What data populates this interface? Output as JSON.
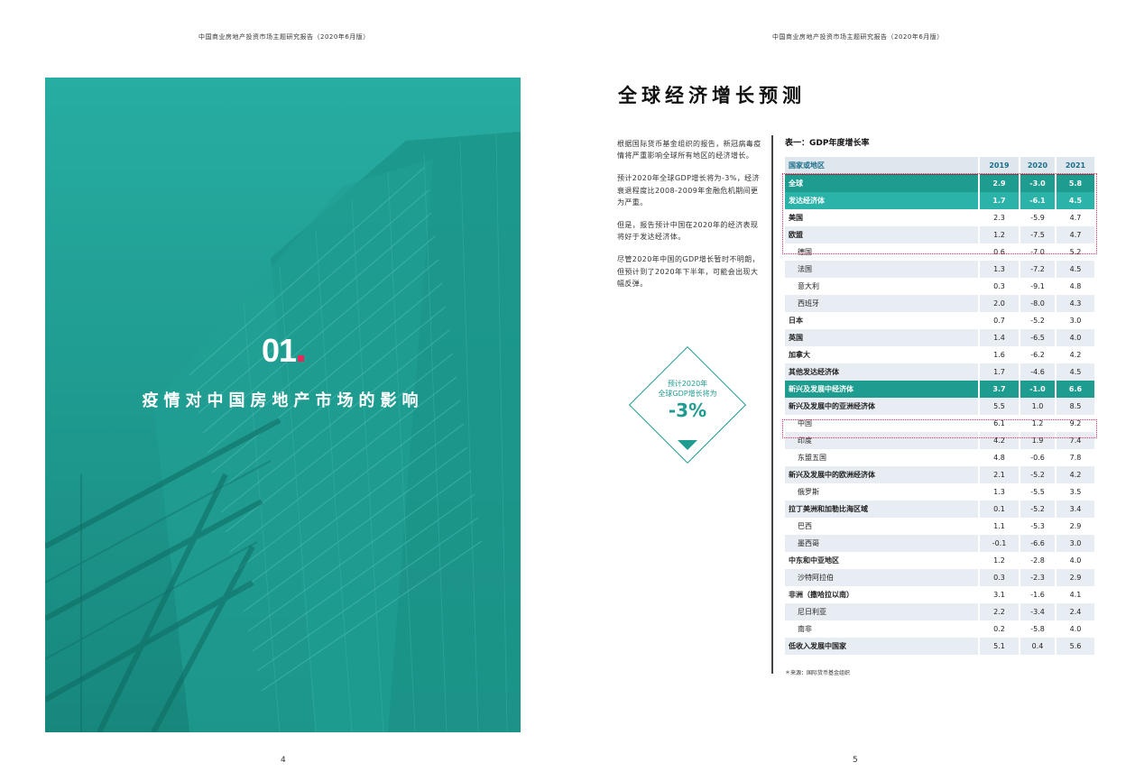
{
  "header": {
    "left": "中国商业房地产投资市场主题研究报告（2020年6月版）",
    "right": "中国商业房地产投资市场主题研究报告（2020年6月版）"
  },
  "left_page": {
    "chapter_number": "01",
    "chapter_title": "疫情对中国房地产市场的影响",
    "page_number": "4",
    "accent_color": "#1f9c90",
    "dot_color": "#e6285a"
  },
  "right_page": {
    "section_title": "全球经济增长预测",
    "paragraphs": [
      "根据国际货币基金组织的报告，新冠病毒疫情将严重影响全球所有地区的经济增长。",
      "预计2020年全球GDP增长将为-3%，经济衰退程度比2008-2009年金融危机期间更为严重。",
      "但是，报告预计中国在2020年的经济表现将好于发达经济体。",
      "尽管2020年中国的GDP增长暂时不明朗，但预计到了2020年下半年，可能会出现大幅反弹。"
    ],
    "callout": {
      "line1": "预计2020年",
      "line2": "全球GDP增长将为",
      "value": "-3%"
    },
    "table_caption": "表一：GDP年度增长率",
    "table_headers": [
      "国家或地区",
      "2019",
      "2020",
      "2021"
    ],
    "rows": [
      {
        "name": "全球",
        "v": [
          "2.9",
          "-3.0",
          "5.8"
        ],
        "style": "hl",
        "indent": false
      },
      {
        "name": "发达经济体",
        "v": [
          "1.7",
          "-6.1",
          "4.5"
        ],
        "style": "hl2",
        "indent": false
      },
      {
        "name": "美国",
        "v": [
          "2.3",
          "-5.9",
          "4.7"
        ],
        "style": "plain",
        "indent": false
      },
      {
        "name": "欧盟",
        "v": [
          "1.2",
          "-7.5",
          "4.7"
        ],
        "style": "alt",
        "indent": false
      },
      {
        "name": "德国",
        "v": [
          "0.6",
          "-7.0",
          "5.2"
        ],
        "style": "plain",
        "indent": true
      },
      {
        "name": "法国",
        "v": [
          "1.3",
          "-7.2",
          "4.5"
        ],
        "style": "alt",
        "indent": true
      },
      {
        "name": "意大利",
        "v": [
          "0.3",
          "-9.1",
          "4.8"
        ],
        "style": "plain",
        "indent": true
      },
      {
        "name": "西班牙",
        "v": [
          "2.0",
          "-8.0",
          "4.3"
        ],
        "style": "alt",
        "indent": true
      },
      {
        "name": "日本",
        "v": [
          "0.7",
          "-5.2",
          "3.0"
        ],
        "style": "plain",
        "indent": false
      },
      {
        "name": "英国",
        "v": [
          "1.4",
          "-6.5",
          "4.0"
        ],
        "style": "alt",
        "indent": false
      },
      {
        "name": "加拿大",
        "v": [
          "1.6",
          "-6.2",
          "4.2"
        ],
        "style": "plain",
        "indent": false
      },
      {
        "name": "其他发达经济体",
        "v": [
          "1.7",
          "-4.6",
          "4.5"
        ],
        "style": "alt",
        "indent": false
      },
      {
        "name": "新兴及发展中经济体",
        "v": [
          "3.7",
          "-1.0",
          "6.6"
        ],
        "style": "hl",
        "indent": false
      },
      {
        "name": "新兴及发展中的亚洲经济体",
        "v": [
          "5.5",
          "1.0",
          "8.5"
        ],
        "style": "alt",
        "indent": false
      },
      {
        "name": "中国",
        "v": [
          "6.1",
          "1.2",
          "9.2"
        ],
        "style": "plain",
        "indent": true
      },
      {
        "name": "印度",
        "v": [
          "4.2",
          "1.9",
          "7.4"
        ],
        "style": "alt",
        "indent": true
      },
      {
        "name": "东盟五国",
        "v": [
          "4.8",
          "-0.6",
          "7.8"
        ],
        "style": "plain",
        "indent": true
      },
      {
        "name": "新兴及发展中的欧洲经济体",
        "v": [
          "2.1",
          "-5.2",
          "4.2"
        ],
        "style": "alt",
        "indent": false
      },
      {
        "name": "俄罗斯",
        "v": [
          "1.3",
          "-5.5",
          "3.5"
        ],
        "style": "plain",
        "indent": true
      },
      {
        "name": "拉丁美洲和加勒比海区域",
        "v": [
          "0.1",
          "-5.2",
          "3.4"
        ],
        "style": "alt",
        "indent": false
      },
      {
        "name": "巴西",
        "v": [
          "1.1",
          "-5.3",
          "2.9"
        ],
        "style": "plain",
        "indent": true
      },
      {
        "name": "墨西哥",
        "v": [
          "-0.1",
          "-6.6",
          "3.0"
        ],
        "style": "alt",
        "indent": true
      },
      {
        "name": "中东和中亚地区",
        "v": [
          "1.2",
          "-2.8",
          "4.0"
        ],
        "style": "plain",
        "indent": false
      },
      {
        "name": "沙特阿拉伯",
        "v": [
          "0.3",
          "-2.3",
          "2.9"
        ],
        "style": "alt",
        "indent": true
      },
      {
        "name": "非洲（撒哈拉以南）",
        "v": [
          "3.1",
          "-1.6",
          "4.1"
        ],
        "style": "plain",
        "indent": false
      },
      {
        "name": "尼日利亚",
        "v": [
          "2.2",
          "-3.4",
          "2.4"
        ],
        "style": "alt",
        "indent": true
      },
      {
        "name": "南非",
        "v": [
          "0.2",
          "-5.8",
          "4.0"
        ],
        "style": "plain",
        "indent": true
      },
      {
        "name": "低收入发展中国家",
        "v": [
          "5.1",
          "0.4",
          "5.6"
        ],
        "style": "alt",
        "indent": false
      }
    ],
    "source_note": "＊来源：国际货币基金组织",
    "page_number": "5"
  }
}
